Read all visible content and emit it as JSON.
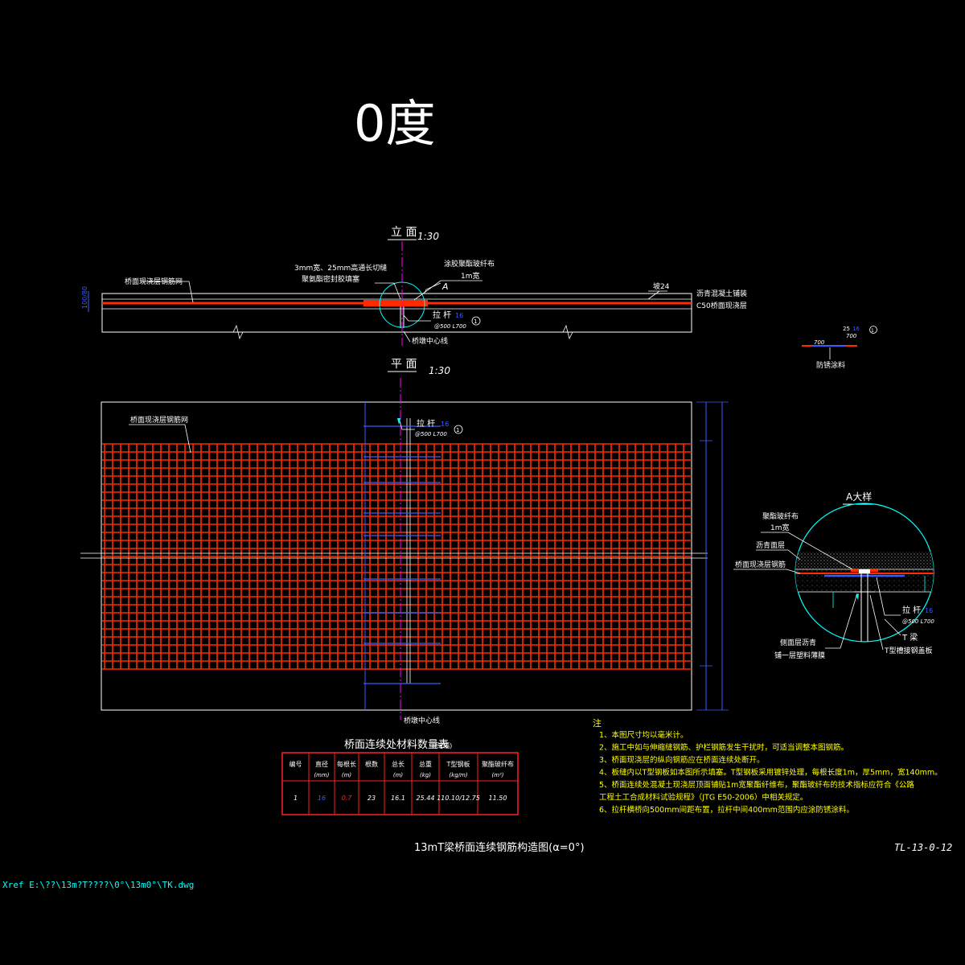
{
  "title_large": "0度",
  "elevation": {
    "heading": "立 面",
    "scale": "1:30",
    "label_rebar_net": "桥面现浇层钢筋网",
    "label_cut_line1": "3mm宽、25mm高通长切缝",
    "label_cut_line2": "聚氨酯密封胶填塞",
    "label_fiber1": "涂胶聚酯玻纤布",
    "label_fiber2": "1m宽",
    "label_A": "A",
    "label_slope": "坡24",
    "label_asphalt": "沥青混凝土铺装",
    "label_c50": "C50桥面现浇层",
    "label_tie_bar": "拉  杆",
    "label_tie_spec": "@500  L700",
    "label_tie_dia": "16",
    "label_circle": "1",
    "label_pier_center": "桥墩中心线",
    "label_left_dim": "100/80"
  },
  "detail_small": {
    "label_top": "25",
    "label_dia": "16",
    "label_circle": "1",
    "label_left": "700",
    "label_right": "700",
    "label_bottom": "防锈涂料"
  },
  "plan": {
    "heading": "平 面",
    "scale": "1:30",
    "label_rebar_net": "桥面现浇层钢筋网",
    "label_tie_bar": "拉  杆",
    "label_tie_dia": "16",
    "label_tie_spec": "@500  L700",
    "label_circle": "1",
    "label_pier_center": "桥墩中心线"
  },
  "detail_a": {
    "heading": "A大样",
    "label_fiber1": "聚酯玻纤布",
    "label_fiber2": "1m宽",
    "label_asphalt": "沥青面层",
    "label_rebar": "桥面现浇层钢筋",
    "label_tie_bar": "拉  杆",
    "label_tie_dia": "16",
    "label_tie_spec": "@500  L700",
    "label_t_beam": "T   梁",
    "label_bottom1": "侧面层沥青",
    "label_bottom2": "铺一层塑料薄膜",
    "label_steel_plate": "T型槽接钢盖板"
  },
  "table": {
    "title": "桥面连续处材料数量表",
    "title_suffix": "(单幅)",
    "headers": [
      "编号",
      "直径",
      "每根长",
      "根数",
      "总长",
      "总重",
      "T型钢板",
      "聚酯玻纤布"
    ],
    "units": [
      "",
      "(mm)",
      "(m)",
      "",
      "(m)",
      "(kg)",
      "(kg/m)",
      "(m²)"
    ],
    "row": [
      "1",
      "16",
      "0.7",
      "23",
      "16.1",
      "25.44",
      "110.10/12.75",
      "11.50"
    ]
  },
  "notes": {
    "heading": "注",
    "items": [
      "1、本图尺寸均以毫米计。",
      "2、施工中如与伸缩缝钢筋、护栏钢筋发生干扰时，可适当调整本图钢筋。",
      "3、桥面现浇层的纵向钢筋应在桥面连续处断开。",
      "4、板缝内以T型钢板如本图所示填塞。T型钢板采用镀锌处理，每根长度1m，厚5mm，宽140mm。",
      "5、桥面连续处混凝土现浇层顶面铺贴1m宽聚酯纤维布，聚酯玻纤布的技术指标应符合《公路",
      "   工程土工合成材料试验规程》（JTG E50-2006）中相关规定。",
      "6、拉杆横桥向500mm间距布置，拉杆中间400mm范围内应涂防锈涂料。"
    ]
  },
  "drawing_title": "13mT梁桥面连续钢筋构造图(α=0°)",
  "drawing_number": "TL-13-0-12",
  "xref": "Xref E:\\??\\13m?T????\\0°\\13m0°\\TK.dwg",
  "colors": {
    "rebar": "#ff2a00",
    "cyan": "#00ffff",
    "magenta": "#ff00ff",
    "blue": "#3a5cff"
  }
}
